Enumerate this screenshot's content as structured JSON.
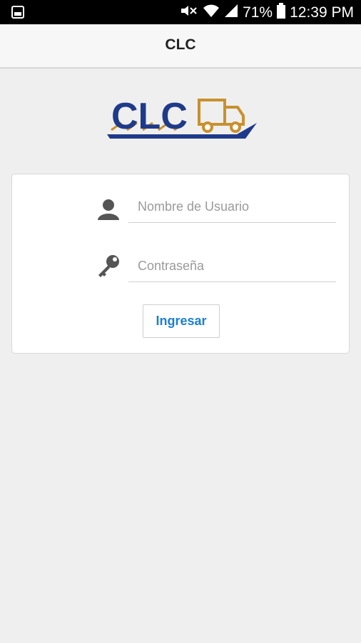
{
  "status_bar": {
    "battery": "71%",
    "time": "12:39 PM",
    "icons": [
      "gallery-notification-icon",
      "mute-icon",
      "wifi-icon",
      "signal-icon",
      "battery-icon"
    ]
  },
  "app_bar": {
    "title": "CLC"
  },
  "logo": {
    "text": "CLC"
  },
  "login": {
    "username_placeholder": "Nombre de Usuario",
    "password_placeholder": "Contraseña",
    "submit_label": "Ingresar",
    "icons": [
      "user-icon",
      "key-icon"
    ]
  },
  "colors": {
    "accent": "#1a7fd6",
    "logo_blue": "#1e3a8a",
    "logo_gold": "#c8902e"
  }
}
